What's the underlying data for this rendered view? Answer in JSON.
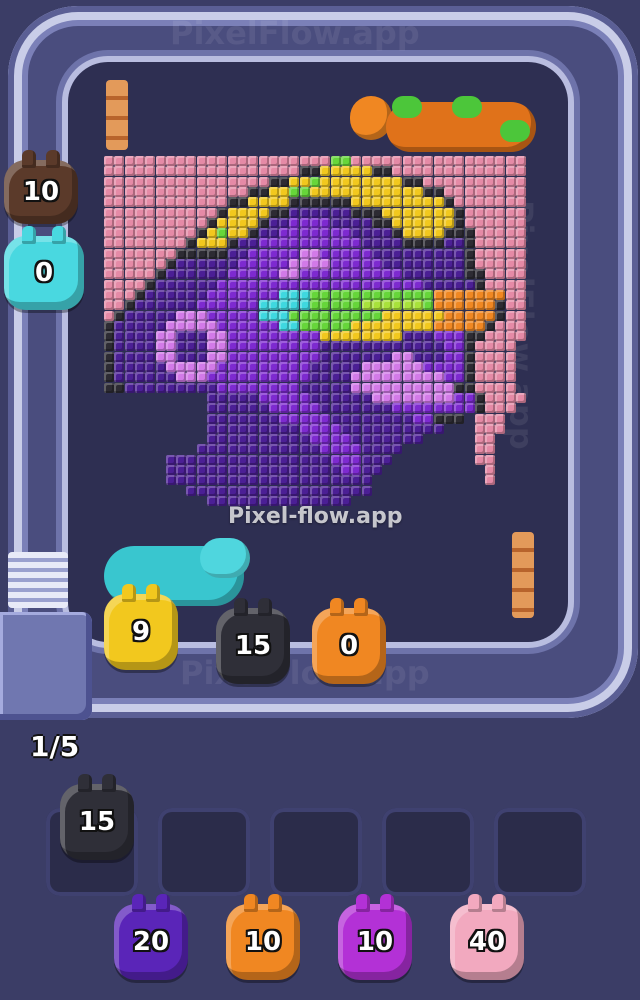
{
  "game": {
    "watermark_top": "PixelFlow.app",
    "watermark_center": "Pixel-flow.app",
    "watermark_bottom": "PixelFlow.app",
    "watermark_side": "PixelFlow.app",
    "slot_counter": "1/5"
  },
  "pixel_palette": {
    "P": "#e58aa6",
    "Y": "#f2c81e",
    "G": "#66d63a",
    "D": "#2d2b33",
    "V": "#4b1f95",
    "M": "#7d2ad0",
    "L": "#d27ae8",
    "C": "#3fd8e0",
    "O": "#f08722",
    "B": "#a8e23b"
  },
  "pixel_rows": [
    "PPPPPPPPPPPPPPPPPPPPPPGGPPPPPPPPPPPPPPPPPPPP",
    "PPPPPPPPPPPPPPPPPPPDDYYYYYDDPPPPPPPPPPPPPPPP",
    "PPPPPPPPPPPPPPPPDDYYGYYYYYYYYDDPPPPPPPPPPPPP",
    "PPPPPPPPPPPPPPDDYYGGYYYYYYYYYYYDDPPPPPPPPPPP",
    "PPPPPPPPPPPPDDYYYYDDDDDDYYYYYYYYYDPPPPPPPPPP",
    "PPPPPPPPPPPDYYYYDDVVVVVVDDDYYYYYYYDPPPPPPPPP",
    "PPPPPPPPPPDYYYYDVVMMMMVVVVDDYYYYYYDPPPPPPPPP",
    "PPPPPPPPPDYGYYDVVMMMMMMMVVVVDYYYYDDDPPPPPPPP",
    "PPPPPPPPDYYYDVVMMMMMMMMMMVVVVDDDDVVDPPPPPPPP",
    "PPPPPPPDDDDDVVMMMMMLLMMMMMVVVVVVVVVDPPPPPPPP",
    "PPPPPPDVVVVVVMMMMMLLLLMMMMMVVVVVVVVDPPPPPPPP",
    "PPPPPDVVVVVVMMMMMLLMMMMMMMMMMVVVVVVDDPPPPPPP",
    "PPPPDVVVVVVMMMMMMMMMMMMMMMMMMMMVVVVVDPPPPPPP",
    "PPPDVVVVVVMMMMMMMCCCGGGGGGGGGGGGOOOOOOOPPPPP",
    "PPDVVVVVVMMMMMMCCCCCGGGGGBBBBBBGOOOOOODPPPP",
    "PDVVVVVLLLMMMMMCCCGGGGGGGGGYYYYYYOOOOODPPP",
    "DVVVVVLLLLLMMMMMMCCGGGGGYYYYYYYYOOOOODPPP",
    "DVVVVLLVVVLLMMMMMMMMMYYYYYYYYVVVMMMDDPPPP",
    "DVVVVLLVVVLLMMMMMMMMMVVVVVVVVVVVVMMDPPPP",
    "DVVVVLLVVVLLMMMMMMMMMVVVVVVVLLVVVMMDPPPP",
    "DVVVVVLLLLLMMMMMMMMMVVVVVLLLLLLMMMMDPPPP",
    "DVVVVVVLLLMMMMMMMMMMVVVVLLLLLLLLLMMDPPPP",
    "DDVVVVVVVVVMMMMMMMMVVVVVLLLLLLLLLLDDPPPP",
    "..........VVVVVMMMMMVVVVVVLLLLLLLLMMDPPPP",
    "..........VVVVVVMMMMMVVVVVVVMMMMMMMMDPPP",
    "..........VVVVVVVMMMMMVVVVVVVVMMDDD.PPP",
    "..........VVVVVVVVVMMMMVVVVVVVVVV...PPP",
    "..........VVVVVVVVVVMMMMVVVVVVV.....PP",
    ".........VVVVVVVVVVVVMMMMVVVV.......PP",
    "......VVVVVVVVVVVVVVVVMMMVVV........PP",
    "......VVVVVVVVVVVVVVVVVMMVV..........P",
    "......VVVVVVVVVVVVVVVVVVVV...........P",
    "........VVVVVVVVVVVVVVVVVV..............",
    "..........VVVVVVVVVVVVVV................"
  ],
  "queue_pigs": [
    {
      "color": "#f2c81e",
      "count": "9"
    },
    {
      "color": "#2f2f38",
      "count": "15"
    },
    {
      "color": "#f08722",
      "count": "0"
    }
  ],
  "side_pigs": [
    {
      "color": "#5b3a2a",
      "count": "10"
    },
    {
      "color": "#49d8e0",
      "count": "0"
    }
  ],
  "slot_pigs": [
    {
      "color": "#2f2f38",
      "count": "15"
    }
  ],
  "reserve_pigs": [
    {
      "color": "#5a25b8",
      "count": "20"
    },
    {
      "color": "#f08722",
      "count": "10"
    },
    {
      "color": "#b331d6",
      "count": "10"
    },
    {
      "color": "#f2a9bf",
      "count": "40"
    }
  ]
}
